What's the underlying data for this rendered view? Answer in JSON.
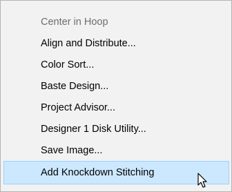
{
  "menu": {
    "items": [
      {
        "label": "Center in Hoop",
        "disabled": true
      },
      {
        "label": "Align and Distribute...",
        "disabled": false
      },
      {
        "label": "Color Sort...",
        "disabled": false
      },
      {
        "label": "Baste Design...",
        "disabled": false
      },
      {
        "label": "Project Advisor...",
        "disabled": false
      },
      {
        "label": "Designer 1 Disk Utility...",
        "disabled": false
      },
      {
        "label": "Save Image...",
        "disabled": false
      },
      {
        "label": "Add Knockdown Stitching",
        "disabled": false,
        "highlighted": true
      }
    ]
  },
  "cursor": {
    "icon": "arrow-cursor-icon"
  },
  "colors": {
    "menu_background": "#f2f2f2",
    "highlight_background": "#cce8ff",
    "highlight_border": "#99d1ff",
    "disabled_text": "#6d6d6d"
  }
}
